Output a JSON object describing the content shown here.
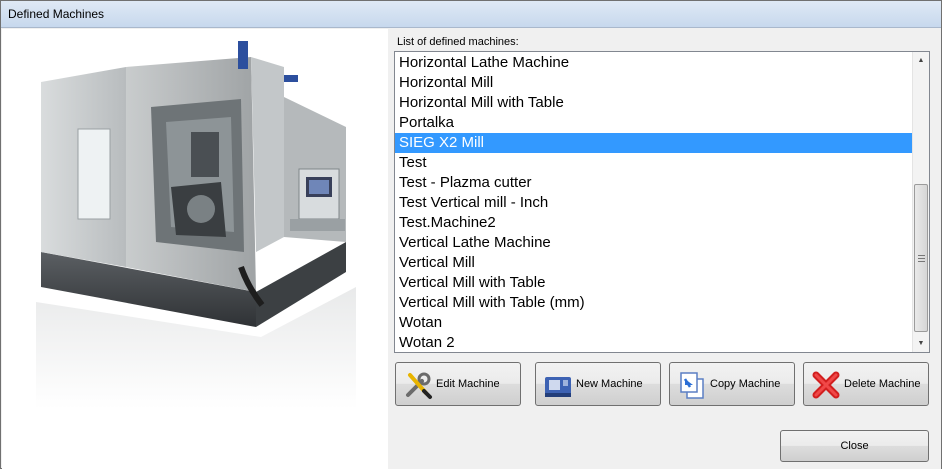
{
  "window": {
    "title": "Defined Machines"
  },
  "list": {
    "label": "List of defined machines:",
    "items": [
      "Horizontal Lathe Machine",
      "Horizontal Mill",
      "Horizontal Mill with Table",
      "Portalka",
      "SIEG X2 Mill",
      "Test",
      "Test - Plazma cutter",
      "Test Vertical mill - Inch",
      "Test.Machine2",
      "Vertical Lathe Machine",
      "Vertical Mill",
      "Vertical Mill with Table",
      "Vertical Mill with Table (mm)",
      "Wotan",
      "Wotan 2"
    ],
    "selected": "SIEG X2 Mill"
  },
  "buttons": {
    "edit": {
      "label": "Edit Machine",
      "icon": "wrench-screwdriver-icon"
    },
    "new": {
      "label": "New Machine",
      "icon": "cnc-machine-icon"
    },
    "copy": {
      "label": "Copy Machine",
      "icon": "copy-document-icon"
    },
    "delete": {
      "label": "Delete Machine",
      "icon": "red-x-icon"
    },
    "close": {
      "label": "Close"
    }
  },
  "colors": {
    "selection": "#3399ff",
    "accent_blue": "#2c4f9e"
  }
}
